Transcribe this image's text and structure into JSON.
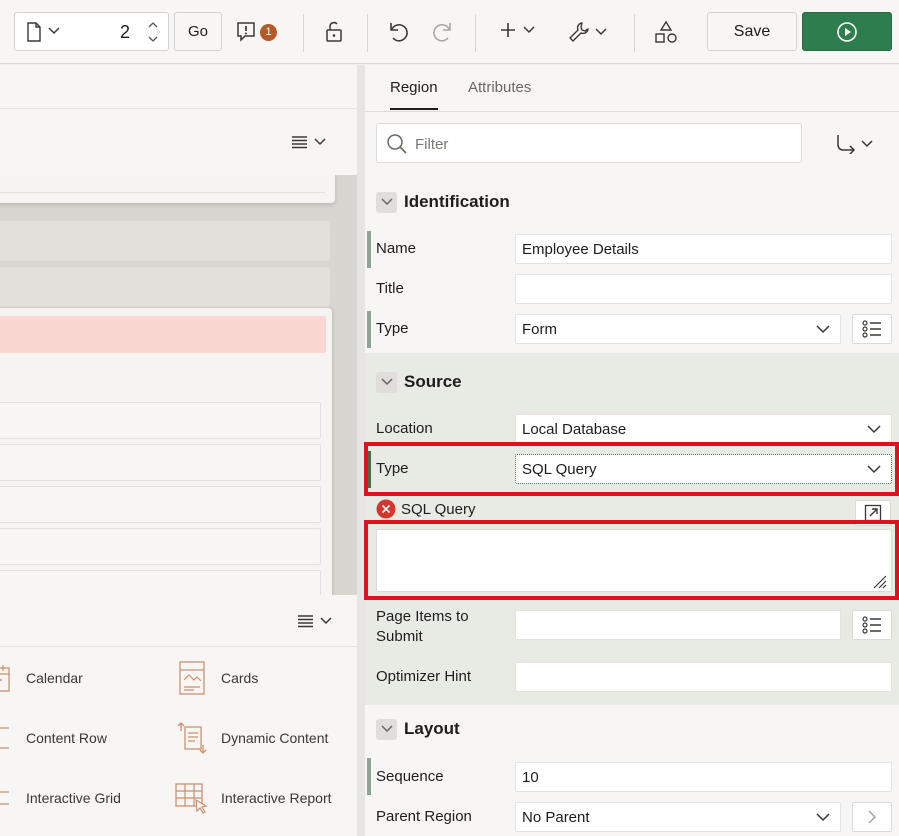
{
  "toolbar": {
    "page_number": "2",
    "go_label": "Go",
    "messages_count": "1",
    "save_label": "Save"
  },
  "property_editor": {
    "tabs": [
      "Region",
      "Attributes"
    ],
    "filter_placeholder": "Filter",
    "identification": {
      "heading": "Identification",
      "name_label": "Name",
      "name_value": "Employee Details",
      "title_label": "Title",
      "title_value": "",
      "type_label": "Type",
      "type_value": "Form"
    },
    "source": {
      "heading": "Source",
      "location_label": "Location",
      "location_value": "Local Database",
      "type_label": "Type",
      "type_value": "SQL Query",
      "sql_query_label": "SQL Query",
      "sql_query_value": "",
      "page_items_label": "Page Items to Submit",
      "page_items_value": "",
      "optimizer_hint_label": "Optimizer Hint",
      "optimizer_hint_value": ""
    },
    "layout": {
      "heading": "Layout",
      "sequence_label": "Sequence",
      "sequence_value": "10",
      "parent_region_label": "Parent Region",
      "parent_region_value": "No Parent"
    }
  },
  "gallery": {
    "items": [
      "Calendar",
      "Cards",
      "Content Row",
      "Dynamic Content",
      "Interactive Grid",
      "Interactive Report"
    ]
  },
  "colors": {
    "accent_green": "#2e7d4f",
    "highlight_red": "#e0101e",
    "badge": "#b45a26",
    "error": "#d1392e",
    "selected_region": "#fbd7d2"
  }
}
